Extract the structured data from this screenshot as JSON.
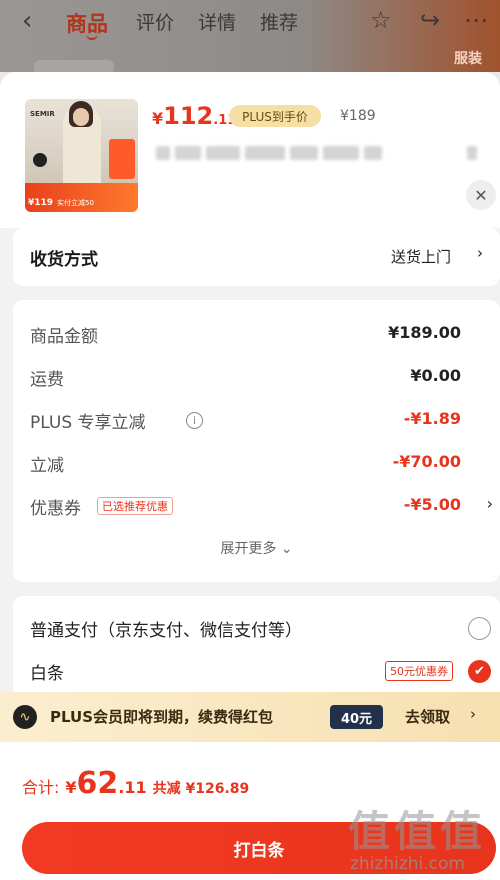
{
  "background": {
    "tabs": [
      "商品",
      "评价",
      "详情",
      "推荐"
    ],
    "active_tab": "商品",
    "promo_badge": "服装"
  },
  "product": {
    "brand_on_thumb": "SEMIR",
    "thumb_price": "¥119",
    "thumb_strip_text": "实付立减50",
    "price_yen": "¥",
    "price_int": "112",
    "price_dec": ".11",
    "plus_tag": "PLUS到手价",
    "original_price": "¥189"
  },
  "shipping": {
    "label": "收货方式",
    "value": "送货上门"
  },
  "fees": {
    "rows": [
      {
        "name": "商品金额",
        "amount": "¥189.00",
        "color": "black"
      },
      {
        "name": "运费",
        "amount": "¥0.00",
        "color": "black"
      },
      {
        "name": "PLUS 专享立减",
        "amount": "-¥1.89",
        "color": "red"
      },
      {
        "name": "立减",
        "amount": "-¥70.00",
        "color": "red"
      },
      {
        "name": "优惠券",
        "amount": "-¥5.00",
        "color": "red"
      }
    ],
    "coupon_tag": "已选推荐优惠",
    "expand_label": "展开更多"
  },
  "payment": {
    "options": [
      {
        "name": "普通支付（京东支付、微信支付等）",
        "selected": false
      },
      {
        "name": "白条",
        "selected": true
      }
    ],
    "baitiao_coupon": "50元优惠券"
  },
  "plus_banner": {
    "icon_glyph": "∿",
    "message": "PLUS会员即将到期，续费得红包",
    "amount": "40元",
    "action": "去领取"
  },
  "footer": {
    "total_label": "合计:",
    "total_yen": "¥",
    "total_int": "62",
    "total_dec": ".11",
    "saved": "共减 ¥126.89",
    "pay_button": "打白条"
  },
  "watermark": {
    "main": "值值值",
    "site": "zhizhizhi.com"
  },
  "colors": {
    "accent": "#e8341c",
    "plus_gold": "#f5dfa5"
  }
}
